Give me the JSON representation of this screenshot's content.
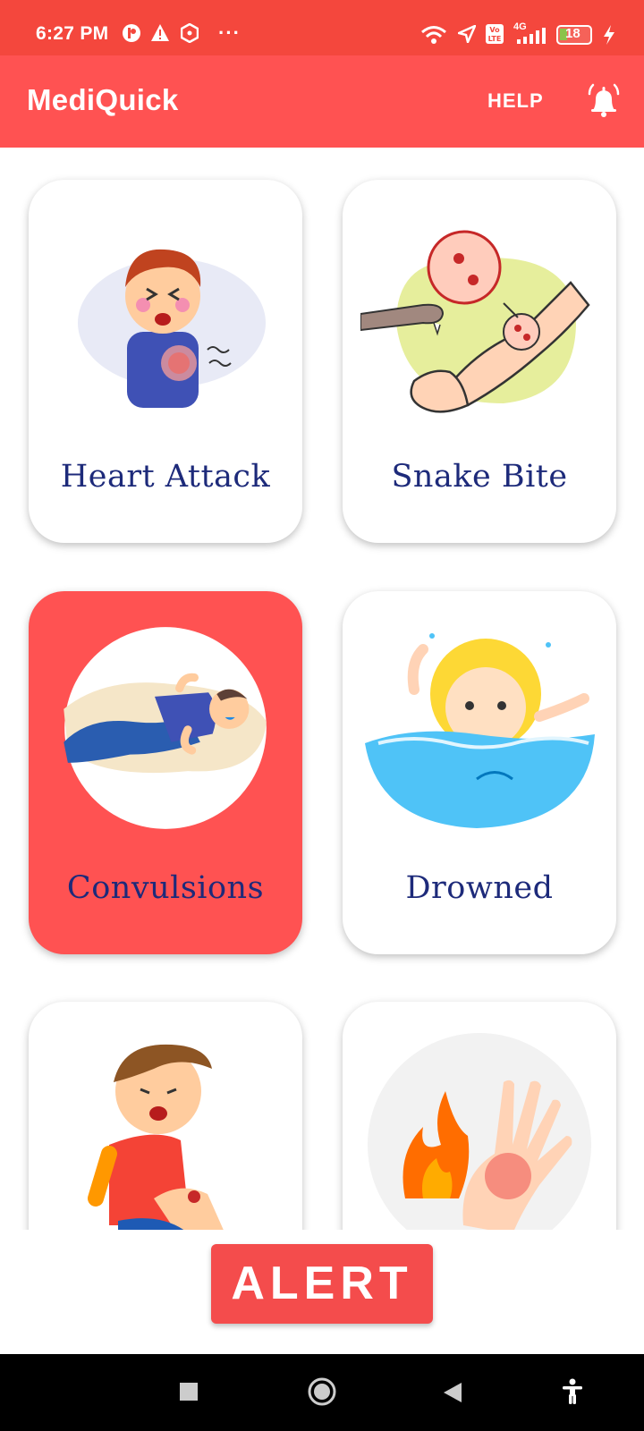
{
  "status_bar": {
    "time": "6:27 PM",
    "battery": "18",
    "network": "4G",
    "icons": [
      "app-notification-icon",
      "warning-icon",
      "shield-icon",
      "more-dots-icon",
      "wifi-icon",
      "location-arrow-icon",
      "volte-icon",
      "signal-icon",
      "battery-icon",
      "charging-icon"
    ],
    "dots": "···"
  },
  "app_bar": {
    "title": "MediQuick",
    "help_label": "HELP",
    "color": "#ff5252"
  },
  "cards": [
    {
      "label": "Heart Attack",
      "icon": "heart-attack-illustration",
      "selected": false
    },
    {
      "label": "Snake Bite",
      "icon": "snake-bite-illustration",
      "selected": false
    },
    {
      "label": "Convulsions",
      "icon": "convulsions-illustration",
      "selected": true
    },
    {
      "label": "Drowned",
      "icon": "drowning-illustration",
      "selected": false
    },
    {
      "label": "",
      "icon": "knee-injury-illustration",
      "selected": false
    },
    {
      "label": "",
      "icon": "burn-hand-illustration",
      "selected": false
    }
  ],
  "alert_button": {
    "label": "ALERT",
    "color": "#f44c4c"
  },
  "nav_bar": {
    "icons": [
      "recents-square-icon",
      "home-circle-icon",
      "back-triangle-icon",
      "accessibility-icon"
    ]
  },
  "colors": {
    "accent": "#ff5252",
    "status": "#f4473d",
    "label": "#1d2a7a"
  }
}
